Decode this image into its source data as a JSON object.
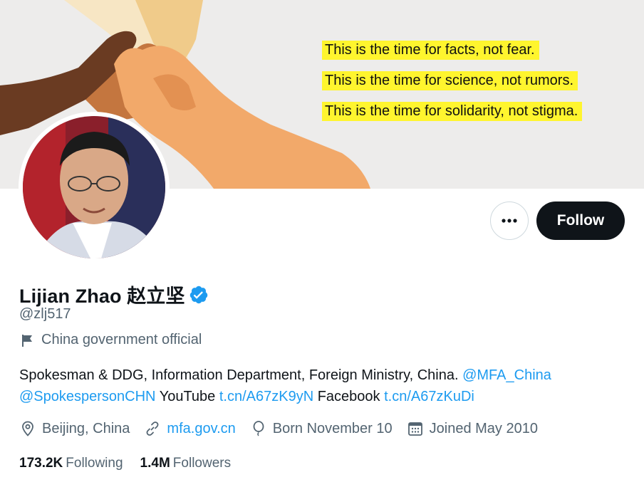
{
  "banner": {
    "lines": [
      "This is the time for facts, not fear.",
      "This is the time for science, not rumors.",
      "This is the time for solidarity, not stigma."
    ]
  },
  "actions": {
    "more_icon": "more-dots-icon",
    "follow_label": "Follow"
  },
  "profile": {
    "name": "Lijian Zhao 赵立坚",
    "handle": "@zlj517",
    "label": "China government official",
    "label_icon": "flag-icon",
    "verified_icon": "verified-badge-icon"
  },
  "bio": {
    "text1": "Spokesman & DDG, Information Department, Foreign Ministry, China. ",
    "mention1": "@MFA_China",
    "mention2": "@SpokespersonCHN",
    "text2": " YouTube ",
    "link1": "t.cn/A67zK9yN",
    "text3": " Facebook ",
    "link2": "t.cn/A67zKuDi"
  },
  "meta": {
    "location": "Beijing, China",
    "website": "mfa.gov.cn",
    "birthday": "Born November 10",
    "joined": "Joined May 2010"
  },
  "stats": {
    "following_count": "173.2K",
    "following_label": "Following",
    "followers_count": "1.4M",
    "followers_label": "Followers"
  },
  "colors": {
    "accent": "#1d9bf0",
    "text": "#0f1419",
    "secondary": "#536471",
    "highlight": "#fff52e"
  }
}
